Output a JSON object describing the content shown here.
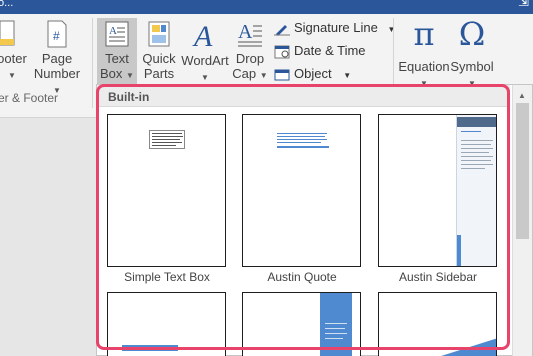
{
  "window": {
    "title_fragment": "o...",
    "pin_symbol": "⇲"
  },
  "ribbon": {
    "footer_btn": {
      "label": "ooter"
    },
    "page_number_btn": {
      "label_line1": "Page",
      "label_line2": "Number"
    },
    "group_header_footer": "er & Footer",
    "text_box_btn": {
      "label_line1": "Text",
      "label_line2": "Box"
    },
    "quick_parts_btn": {
      "label_line1": "Quick",
      "label_line2": "Parts"
    },
    "wordart_btn": {
      "label": "WordArt"
    },
    "drop_cap_btn": {
      "label_line1": "Drop",
      "label_line2": "Cap"
    },
    "signature_line": "Signature Line",
    "date_time": "Date & Time",
    "object": "Object",
    "equation_btn": {
      "label": "Equation",
      "glyph": "π"
    },
    "symbol_btn": {
      "label": "Symbol",
      "glyph": "Ω"
    }
  },
  "gallery": {
    "header": "Built-in",
    "items": [
      {
        "label": "Simple Text Box"
      },
      {
        "label": "Austin Quote"
      },
      {
        "label": "Austin Sidebar"
      }
    ]
  },
  "colors": {
    "accent": "#2b579a",
    "highlight": "#e8436a",
    "austin_blue": "#4f8ad0"
  }
}
